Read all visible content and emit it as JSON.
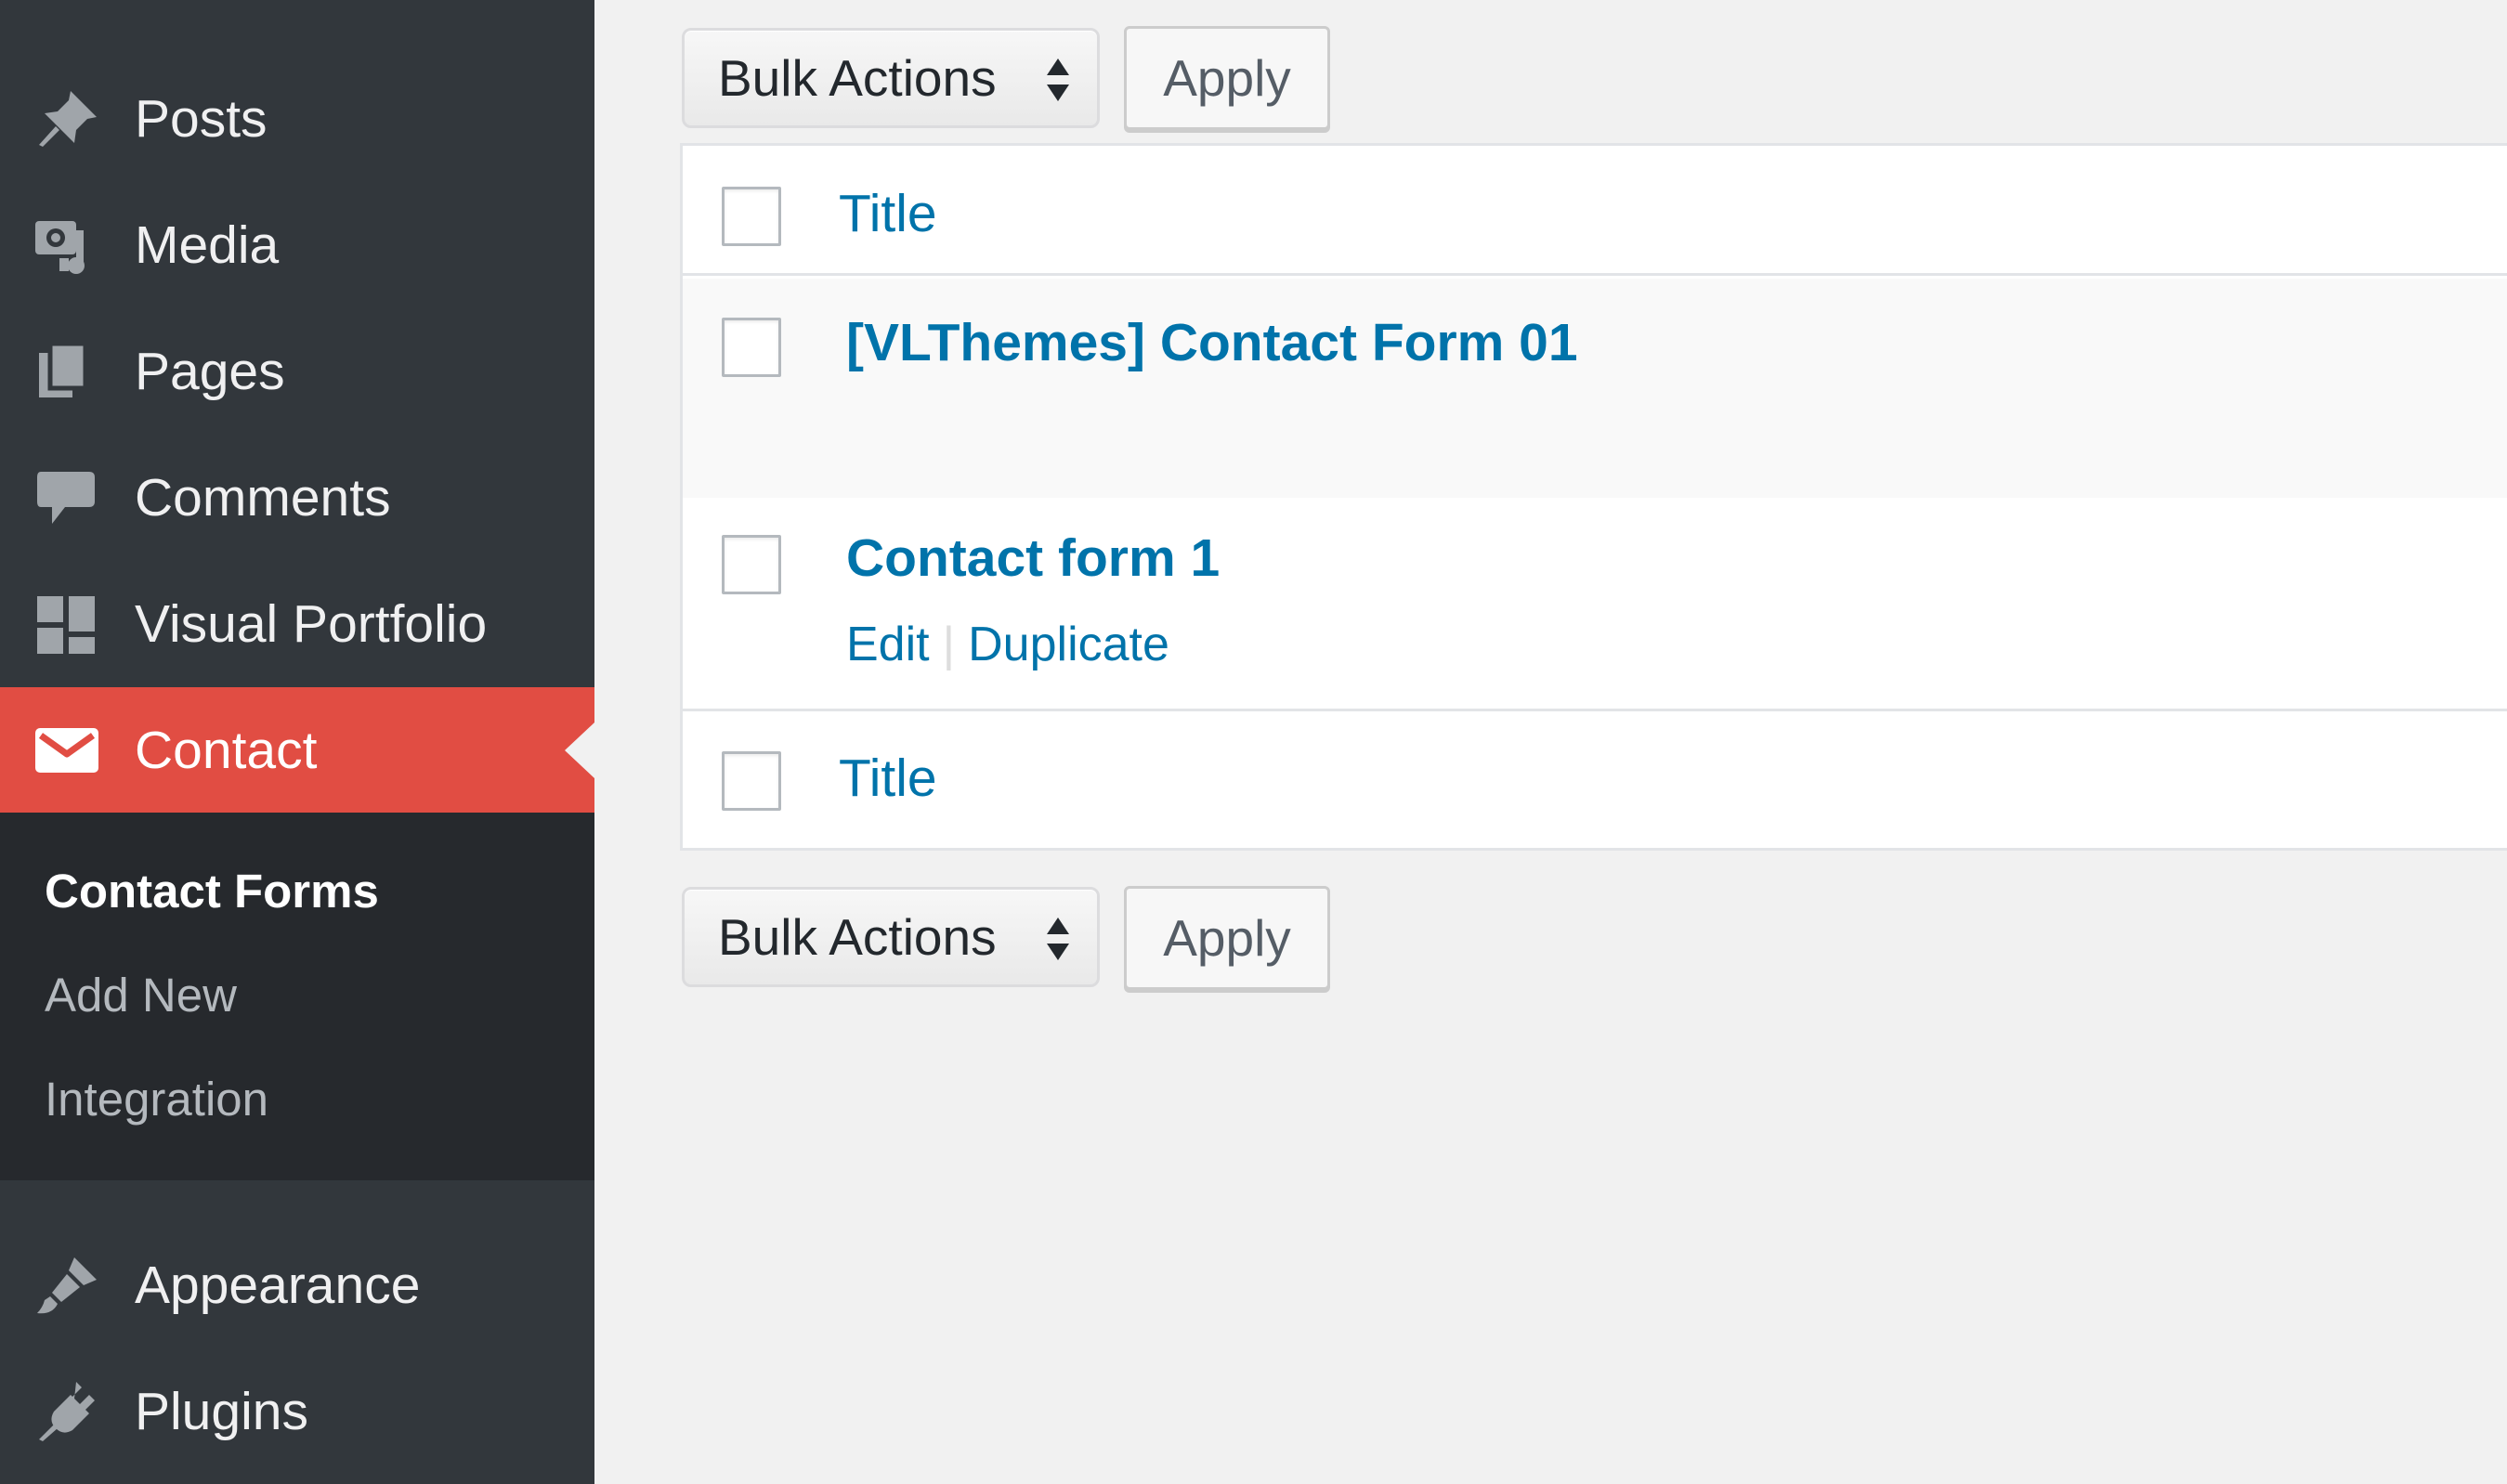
{
  "sidebar": {
    "items": [
      {
        "label": "Posts",
        "icon": "pin-icon"
      },
      {
        "label": "Media",
        "icon": "media-icon"
      },
      {
        "label": "Pages",
        "icon": "pages-icon"
      },
      {
        "label": "Comments",
        "icon": "comment-icon"
      },
      {
        "label": "Visual Portfolio",
        "icon": "grid-icon"
      },
      {
        "label": "Contact",
        "icon": "mail-icon",
        "active": true
      },
      {
        "label": "Appearance",
        "icon": "brush-icon"
      },
      {
        "label": "Plugins",
        "icon": "plug-icon"
      }
    ],
    "submenu": [
      {
        "label": "Contact Forms",
        "current": true
      },
      {
        "label": "Add New"
      },
      {
        "label": "Integration"
      }
    ],
    "colors": {
      "background": "#32373c",
      "active": "#e14d43",
      "submenu_bg": "#26292d"
    }
  },
  "toolbar_top": {
    "bulk_actions": "Bulk Actions",
    "apply": "Apply"
  },
  "toolbar_bottom": {
    "bulk_actions": "Bulk Actions",
    "apply": "Apply"
  },
  "table": {
    "header_title": "Title",
    "footer_title": "Title",
    "rows": [
      {
        "title": "[VLThemes] Contact Form 01"
      },
      {
        "title": "Contact form 1",
        "actions": [
          "Edit",
          "Duplicate"
        ]
      }
    ]
  },
  "colors": {
    "link": "#0073aa",
    "page_bg": "#f1f1f1"
  }
}
